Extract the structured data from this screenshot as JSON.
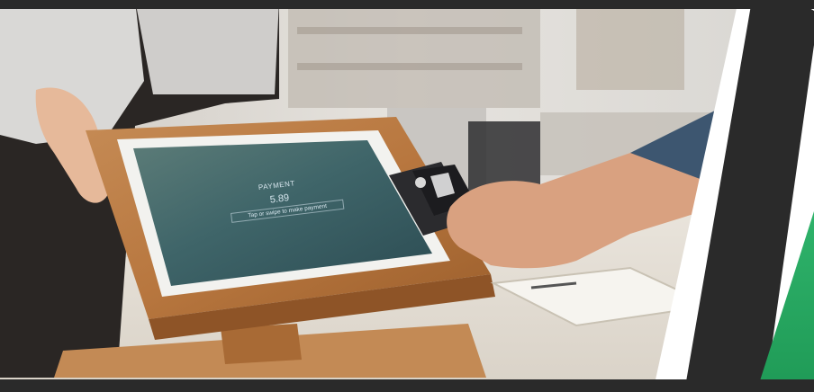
{
  "terminal_screen": {
    "title": "PAYMENT",
    "amount": "5.89",
    "instruction": "Tap or swipe to make payment"
  }
}
